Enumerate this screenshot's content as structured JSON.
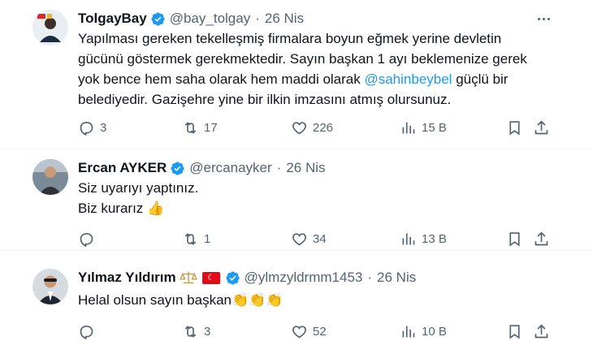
{
  "tweets": [
    {
      "name": "TolgayBay",
      "handle": "@bay_tolgay",
      "sep": "·",
      "date": "26 Nis",
      "text_lines": [
        "Yapılması gereken tekelleşmiş firmalara boyun eğmek yerine devletin",
        "gücünü göstermek gerekmektedir. Sayın başkan 1 ayı beklemenize  gerek",
        "yok bence hem saha olarak hem maddi olarak "
      ],
      "mention": "@sahinbeybel",
      "text_after_mention": " güçlü bir",
      "text_last": "belediyedir. Gazişehre yine bir ilkin imzasını atmış olursunuz.",
      "replies": "3",
      "retweets": "17",
      "likes": "226",
      "views": "15 B"
    },
    {
      "name": "Ercan AYKER",
      "handle": "@ercanayker",
      "sep": "·",
      "date": "26 Nis",
      "text_lines": [
        "Siz uyarıyı yaptınız.",
        "Biz kurarız "
      ],
      "emoji": "👍",
      "replies": "",
      "retweets": "1",
      "likes": "34",
      "views": "13 B"
    },
    {
      "name": "Yılmaz Yıldırım",
      "handle": "@ylmzyldrmm1453",
      "sep": "·",
      "date": "26 Nis",
      "text_lines": [
        "Helal olsun sayın başkan"
      ],
      "emoji": "👏👏👏",
      "replies": "",
      "retweets": "3",
      "likes": "52",
      "views": "10 B"
    }
  ],
  "colors": {
    "accent": "#1d9bf0",
    "muted": "#536471",
    "text": "#0f1419",
    "divider": "#eff3f4",
    "flag_red": "#e30a17",
    "scale_gold": "#c8a04a"
  },
  "icons": {
    "reply": "speech-bubble-icon",
    "retweet": "retweet-icon",
    "like": "heart-icon",
    "views": "bar-chart-icon",
    "bookmark": "bookmark-icon",
    "share": "share-upload-icon",
    "verified": "verified-badge-icon",
    "more": "more-dots-icon"
  }
}
